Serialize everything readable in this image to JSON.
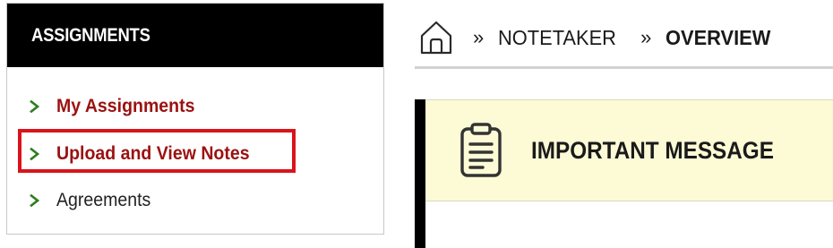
{
  "sidebar": {
    "title": "ASSIGNMENTS",
    "items": [
      {
        "label": "My Assignments",
        "style": "link",
        "icon": "chevron-right-icon"
      },
      {
        "label": "Upload and View Notes",
        "style": "link",
        "highlighted": true,
        "icon": "chevron-right-icon"
      },
      {
        "label": "Agreements",
        "style": "plain",
        "icon": "chevron-right-icon"
      }
    ]
  },
  "breadcrumb": {
    "home_icon": "home-icon",
    "separator": "»",
    "items": [
      {
        "label": "NOTETAKER"
      },
      {
        "label": "OVERVIEW",
        "current": true
      }
    ]
  },
  "message": {
    "icon": "clipboard-icon",
    "title": "IMPORTANT MESSAGE"
  },
  "colors": {
    "sidebar_header_bg": "#000000",
    "link_text": "#9b1111",
    "chevron": "#2e7d1e",
    "highlight_border": "#d9141b",
    "message_bg": "#fcfbd6"
  }
}
